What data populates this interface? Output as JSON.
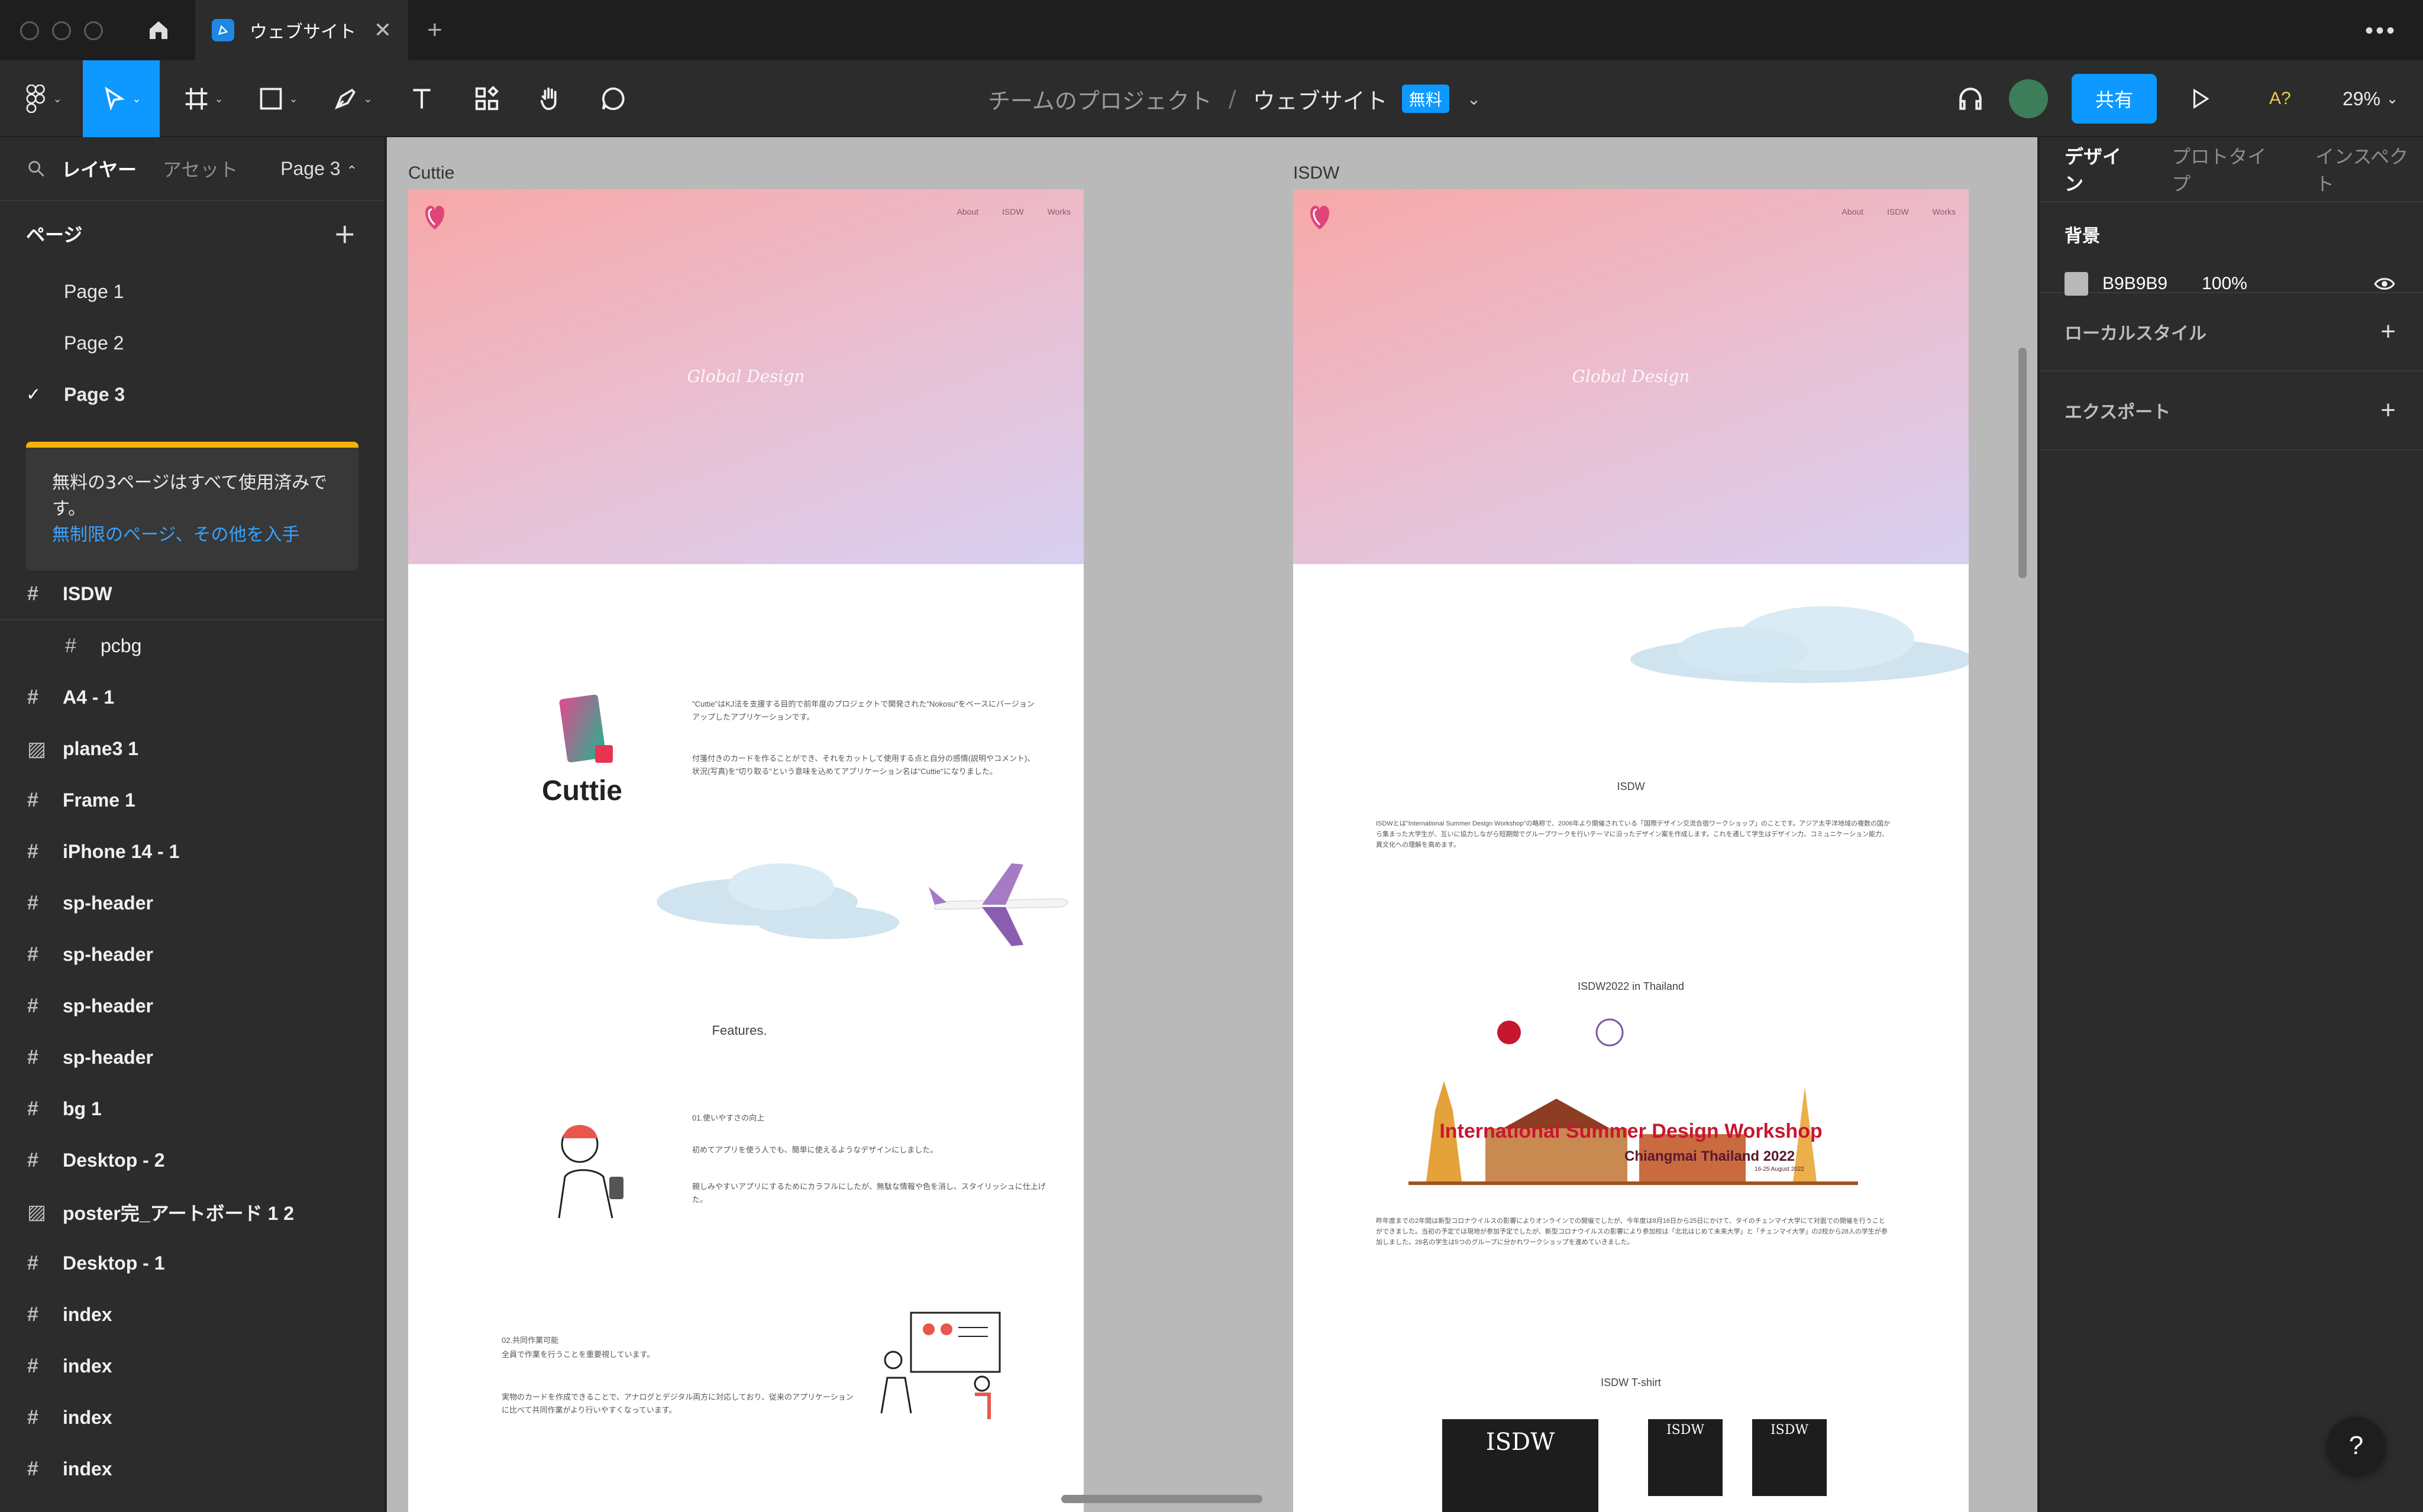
{
  "tabbar": {
    "tab_title": "ウェブサイト",
    "close_glyph": "✕",
    "new_tab_glyph": "+",
    "more_glyph": "•••"
  },
  "toolbar": {
    "project": "チームのプロジェクト",
    "separator": "/",
    "file_name": "ウェブサイト",
    "plan_badge": "無料",
    "share_label": "共有",
    "font_badge": "A?",
    "zoom": "29%"
  },
  "left_panel": {
    "tab_layers": "レイヤー",
    "tab_assets": "アセット",
    "current_page": "Page 3",
    "pages_heading": "ページ",
    "pages": [
      {
        "label": "Page 1",
        "selected": false
      },
      {
        "label": "Page 2",
        "selected": false
      },
      {
        "label": "Page 3",
        "selected": true
      }
    ],
    "promo_text": "無料の3ページはすべて使用済みです。",
    "promo_link": "無制限のページ、その他を入手",
    "layers": [
      {
        "label": "ISDW",
        "icon": "frame-icon"
      },
      {
        "label": "pcbg",
        "icon": "frame-icon",
        "child": true
      },
      {
        "label": "A4 - 1",
        "icon": "frame-icon"
      },
      {
        "label": "plane3 1",
        "icon": "image-icon"
      },
      {
        "label": "Frame 1",
        "icon": "frame-icon"
      },
      {
        "label": "iPhone 14 - 1",
        "icon": "frame-icon"
      },
      {
        "label": "sp-header",
        "icon": "frame-icon"
      },
      {
        "label": "sp-header",
        "icon": "frame-icon"
      },
      {
        "label": "sp-header",
        "icon": "frame-icon"
      },
      {
        "label": "sp-header",
        "icon": "frame-icon"
      },
      {
        "label": "bg 1",
        "icon": "frame-icon"
      },
      {
        "label": "Desktop - 2",
        "icon": "frame-icon"
      },
      {
        "label": "poster完_アートボード 1 2",
        "icon": "image-icon"
      },
      {
        "label": "Desktop - 1",
        "icon": "frame-icon"
      },
      {
        "label": "index",
        "icon": "frame-icon"
      },
      {
        "label": "index",
        "icon": "frame-icon"
      },
      {
        "label": "index",
        "icon": "frame-icon"
      },
      {
        "label": "index",
        "icon": "frame-icon"
      }
    ]
  },
  "canvas": {
    "background": "#B9B9B9",
    "cuttie": {
      "label": "Cuttie",
      "nav": [
        "About",
        "ISDW",
        "Works"
      ],
      "hero_title": "Global Design",
      "brand": "Cuttie",
      "intro1": "\"Cuttie\"はKJ法を支援する目的で前年度のプロジェクトで開発された\"Nokosu\"をベースにバージョンアップしたアプリケーションです。",
      "intro2": "付箋付きのカードを作ることができ、それをカットして使用する点と自分の感情(説明やコメント)、状況(写真)を\"切り取る\"という意味を込めてアプリケーション名は\"Cuttie\"になりました。",
      "features_title": "Features.",
      "f1_title": "01.使いやすさの向上",
      "f1_text1": "初めてアプリを使う人でも、簡単に使えるようなデザインにしました。",
      "f1_text2": "親しみやすいアプリにするためにカラフルにしたが、無駄な情報や色を消し、スタイリッシュに仕上げた。",
      "f2_title": "02.共同作業可能",
      "f2_sub": "全員で作業を行うことを重要視しています。",
      "f2_text": "実物のカードを作成できることで、アナログとデジタル両方に対応しており、従来のアプリケーションに比べて共同作業がより行いやすくなっています。"
    },
    "isdw": {
      "label": "ISDW",
      "nav": [
        "About",
        "ISDW",
        "Works"
      ],
      "hero_title": "Global Design",
      "about_title": "ISDW",
      "about_text": "ISDWとは\"International Summer Design Workshop\"の略称で、2006年より開催されている「国際デザイン交流合宿ワークショップ」のことです。アジア太平洋地域の複数の国から集まった大学生が、互いに協力しながら短期間でグループワークを行いテーマに沿ったデザイン案を作成します。これを通して学生はデザイン力、コミュニケーション能力、異文化への理解を高めます。",
      "event_title": "ISDW2022 in Thailand",
      "poster_title": "International Summer Design Workshop",
      "poster_sub": "Chiangmai Thailand 2022",
      "poster_date": "16-25 August 2022",
      "event_text": "昨年度までの2年間は新型コロナウイルスの影響によりオンラインでの開催でしたが、今年度は8月16日から25日にかけて、タイのチェンマイ大学にて対面での開催を行うことができました。当初の予定では現地が参加予定でしたが、新型コロナウイルスの影響により参加校は「北北はじめて未来大学」と「チェンマイ大学」の2校から28人の学生が参加しました。28名の学生は5つのグループに分かれワークショップを進めていきました。",
      "tshirt_title": "ISDW T-shirt",
      "tshirt_label": "ISDW"
    }
  },
  "right_panel": {
    "tab_design": "デザイン",
    "tab_prototype": "プロトタイプ",
    "tab_inspect": "インスペクト",
    "bg_title": "背景",
    "bg_hex": "B9B9B9",
    "bg_opacity": "100%",
    "local_styles": "ローカルスタイル",
    "export": "エクスポート"
  },
  "help_label": "?"
}
